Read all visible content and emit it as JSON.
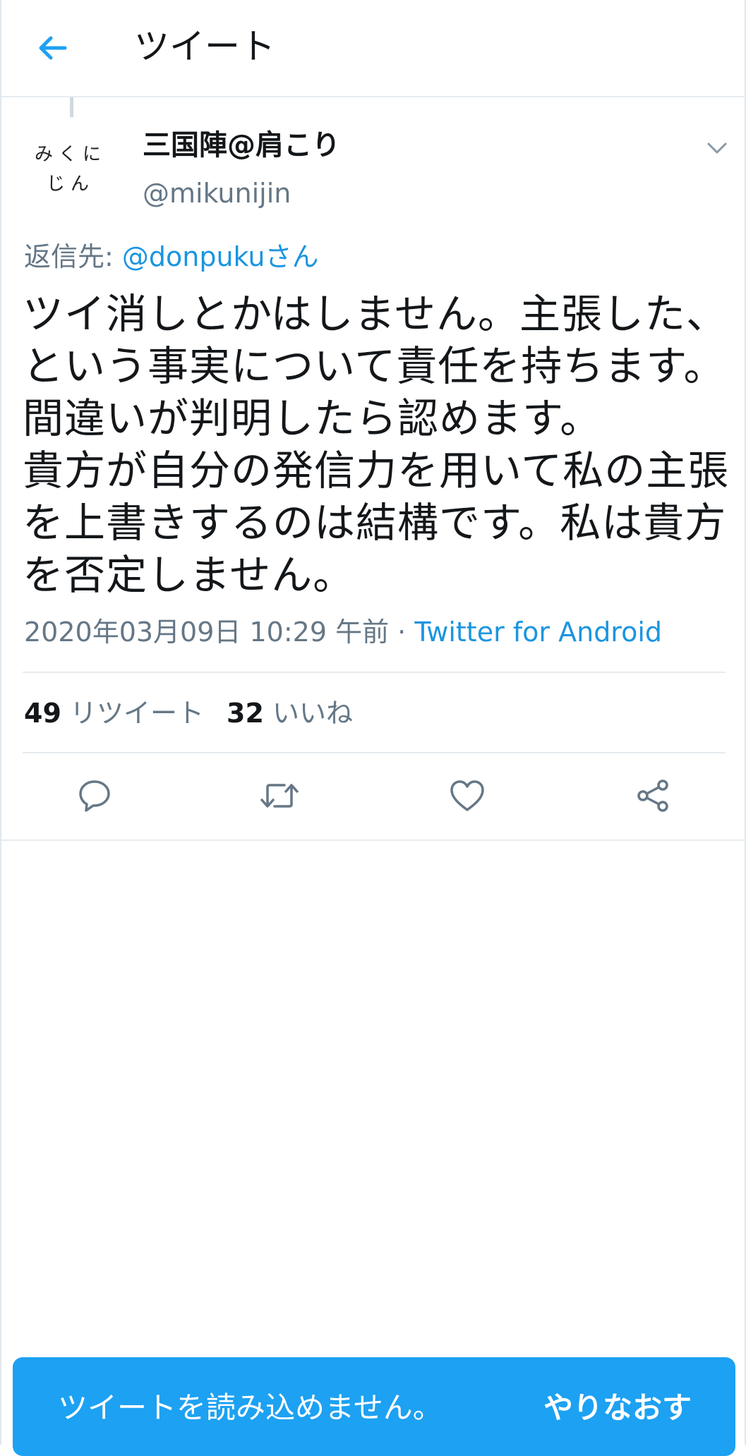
{
  "header": {
    "title": "ツイート",
    "back_icon": "arrow-left-icon"
  },
  "author": {
    "avatar_lines": [
      "みくに",
      "じん"
    ],
    "name": "三国陣@肩こり",
    "handle": "@mikunijin",
    "menu_icon": "chevron-down-icon"
  },
  "reply": {
    "prefix": "返信先: ",
    "mention": "@donpukuさん"
  },
  "tweet": {
    "lines": [
      "ツイ消しとかはしません。主張した、",
      "という事実について責任を持ちます。",
      "間違いが判明したら認めます。",
      "貴方が自分の発信力を用いて私の主張",
      "を上書きするのは結構です。私は貴方",
      "を否定しません。"
    ],
    "timestamp": "2020年03月09日 10:29 午前",
    "separator": " · ",
    "source": "Twitter for Android"
  },
  "stats": {
    "retweets_count": "49",
    "retweets_label": "リツイート",
    "likes_count": "32",
    "likes_label": "いいね"
  },
  "actions": {
    "reply_icon": "reply-icon",
    "retweet_icon": "retweet-icon",
    "like_icon": "heart-icon",
    "share_icon": "share-icon"
  },
  "snackbar": {
    "message": "ツイートを読み込めません。",
    "action": "やりなおす"
  },
  "colors": {
    "accent": "#1da1f2",
    "link": "#1b95e0",
    "secondary_text": "#657786",
    "divider": "#e6ecf0"
  }
}
